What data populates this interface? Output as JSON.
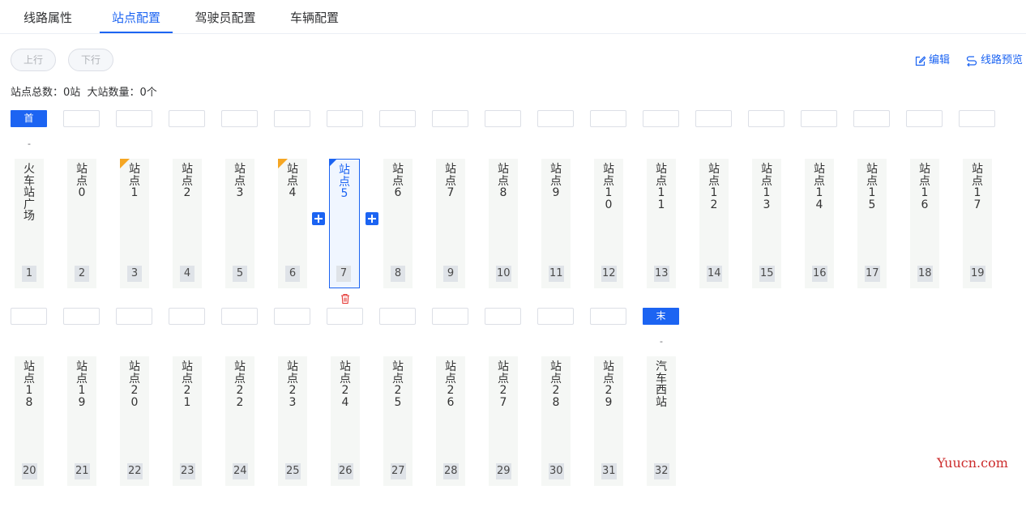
{
  "tabs": [
    {
      "label": "线路属性",
      "active": false
    },
    {
      "label": "站点配置",
      "active": true
    },
    {
      "label": "驾驶员配置",
      "active": false
    },
    {
      "label": "车辆配置",
      "active": false
    }
  ],
  "direction": {
    "up_label": "上行",
    "down_label": "下行"
  },
  "actions": {
    "edit_label": "编辑",
    "preview_label": "线路预览"
  },
  "summary": {
    "text": "站点总数：0站  大站数量：0个"
  },
  "start_badge": "首",
  "end_badge": "末",
  "dash": "-",
  "stations": [
    {
      "name": "火车站广场",
      "index": "1"
    },
    {
      "name": "站点0",
      "index": "2"
    },
    {
      "name": "站点1",
      "index": "3",
      "flag": true
    },
    {
      "name": "站点2",
      "index": "4"
    },
    {
      "name": "站点3",
      "index": "5"
    },
    {
      "name": "站点4",
      "index": "6",
      "flag": true
    },
    {
      "name": "站点5",
      "index": "7",
      "selected": true
    },
    {
      "name": "站点6",
      "index": "8"
    },
    {
      "name": "站点7",
      "index": "9"
    },
    {
      "name": "站点8",
      "index": "10"
    },
    {
      "name": "站点9",
      "index": "11"
    },
    {
      "name": "站点10",
      "index": "12"
    },
    {
      "name": "站点11",
      "index": "13"
    },
    {
      "name": "站点12",
      "index": "14"
    },
    {
      "name": "站点13",
      "index": "15"
    },
    {
      "name": "站点14",
      "index": "16"
    },
    {
      "name": "站点15",
      "index": "17"
    },
    {
      "name": "站点16",
      "index": "18"
    },
    {
      "name": "站点17",
      "index": "19"
    },
    {
      "name": "站点18",
      "index": "20"
    },
    {
      "name": "站点19",
      "index": "21"
    },
    {
      "name": "站点20",
      "index": "22"
    },
    {
      "name": "站点21",
      "index": "23"
    },
    {
      "name": "站点22",
      "index": "24"
    },
    {
      "name": "站点23",
      "index": "25"
    },
    {
      "name": "站点24",
      "index": "26"
    },
    {
      "name": "站点25",
      "index": "27"
    },
    {
      "name": "站点26",
      "index": "28"
    },
    {
      "name": "站点27",
      "index": "29"
    },
    {
      "name": "站点28",
      "index": "30"
    },
    {
      "name": "站点29",
      "index": "31"
    },
    {
      "name": "汽车西站",
      "index": "32"
    }
  ],
  "watermark": "Yuucn.com",
  "colors": {
    "accent": "#1c64f2",
    "flag": "#f5a623",
    "delete": "#e53935"
  }
}
